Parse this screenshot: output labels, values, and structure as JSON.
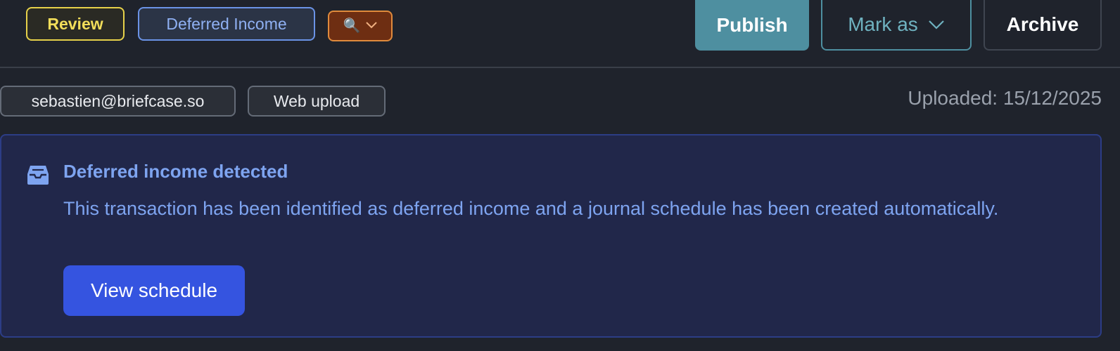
{
  "tags": {
    "status": "Review",
    "category": "Deferred Income",
    "filter_icon": "magnifier-icon",
    "filter_chevron": "⌄"
  },
  "actions": {
    "publish": "Publish",
    "mark_as": "Mark as",
    "archive": "Archive"
  },
  "meta": {
    "email": "sebastien@briefcase.so",
    "source": "Web upload",
    "uploaded": "Uploaded: 15/12/2025"
  },
  "alert": {
    "icon": "inbox-icon",
    "title": "Deferred income detected",
    "body": "This transaction has been identified as deferred income and a journal schedule has been created automatically.",
    "button": "View schedule"
  },
  "colors": {
    "background": "#1f232c",
    "accent_teal": "#4e8fa0",
    "alert_blue": "#7ea4f0",
    "button_blue": "#3554e0",
    "review_yellow": "#e6d14a",
    "filter_orange": "#e08a3c"
  }
}
